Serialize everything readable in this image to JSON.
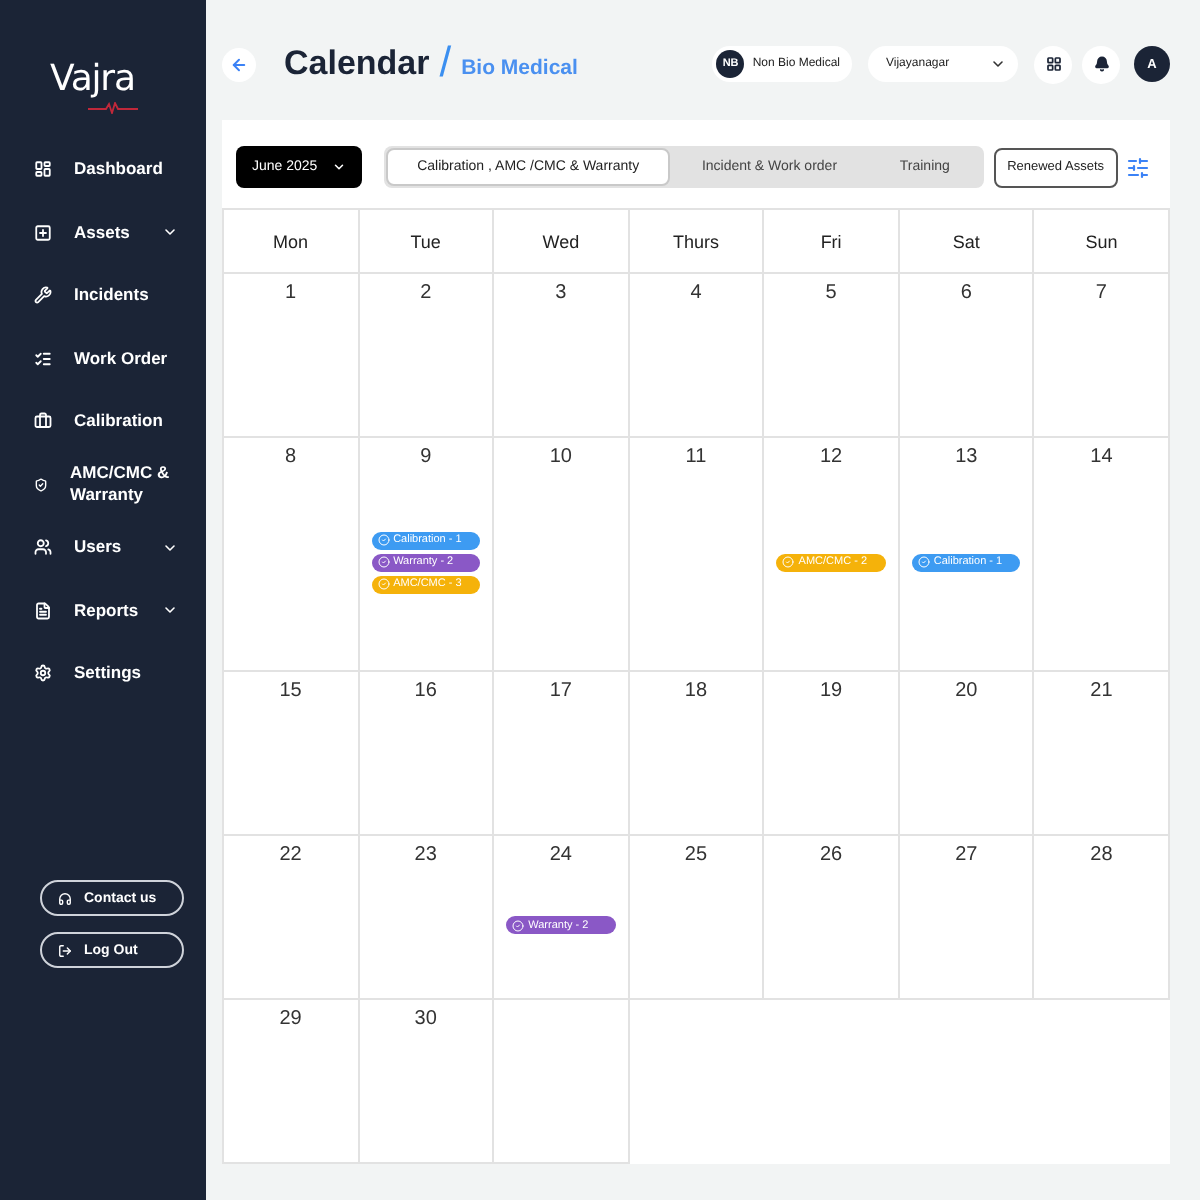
{
  "sidebar": {
    "logo": "Vajra",
    "nav_items": [
      {
        "label": "Dashboard",
        "submenu": false
      },
      {
        "label": "Assets",
        "submenu": true
      },
      {
        "label": "Incidents",
        "submenu": false
      },
      {
        "label": "Work Order",
        "submenu": false
      },
      {
        "label": "Calibration",
        "submenu": false
      },
      {
        "label": "AMC/CMC & Warranty",
        "submenu": false
      },
      {
        "label": "Users",
        "submenu": true
      },
      {
        "label": "Reports",
        "submenu": true
      },
      {
        "label": "Settings",
        "submenu": false
      }
    ],
    "footer_buttons": [
      "Contact us",
      "Log Out"
    ]
  },
  "header": {
    "title": "Calendar",
    "separator": "/",
    "subtitle": "Bio Medical",
    "org_switch": {
      "initials": "NB",
      "label": "Non Bio Medical"
    },
    "location": {
      "value": "Vijayanagar"
    },
    "avatar": "A"
  },
  "toolbar": {
    "month": "June 2025",
    "tabs": [
      {
        "label": "Calibration , AMC /CMC & Warranty",
        "selected": true
      },
      {
        "label": "Incident & Work order",
        "selected": false
      },
      {
        "label": "Training",
        "selected": false
      }
    ],
    "renewed_button": "Renewed Assets"
  },
  "calendar": {
    "weekdays": [
      "Mon",
      "Tue",
      "Wed",
      "Thurs",
      "Fri",
      "Sat",
      "Sun"
    ],
    "weeks": [
      [
        {
          "kind": "day",
          "day": "1"
        },
        {
          "kind": "day",
          "day": "2"
        },
        {
          "kind": "day",
          "day": "3"
        },
        {
          "kind": "day",
          "day": "4"
        },
        {
          "kind": "day",
          "day": "5"
        },
        {
          "kind": "day",
          "day": "6"
        },
        {
          "kind": "day",
          "day": "7"
        }
      ],
      [
        {
          "kind": "day",
          "day": "8"
        },
        {
          "kind": "day",
          "day": "9",
          "events": [
            {
              "label": "Calibration - 1",
              "color": "#3d9bf2"
            },
            {
              "label": "Warranty - 2",
              "color": "#8a58c6"
            },
            {
              "label": "AMC/CMC - 3",
              "color": "#f5b20a"
            }
          ]
        },
        {
          "kind": "day",
          "day": "10"
        },
        {
          "kind": "day",
          "day": "11"
        },
        {
          "kind": "day",
          "day": "12",
          "events": [
            {
              "label": "AMC/CMC - 2",
              "color": "#f5b20a"
            }
          ]
        },
        {
          "kind": "day",
          "day": "13",
          "events": [
            {
              "label": "Calibration - 1",
              "color": "#3d9bf2"
            }
          ]
        },
        {
          "kind": "day",
          "day": "14"
        }
      ],
      [
        {
          "kind": "day",
          "day": "15"
        },
        {
          "kind": "day",
          "day": "16"
        },
        {
          "kind": "day",
          "day": "17"
        },
        {
          "kind": "day",
          "day": "18"
        },
        {
          "kind": "day",
          "day": "19"
        },
        {
          "kind": "day",
          "day": "20"
        },
        {
          "kind": "day",
          "day": "21"
        }
      ],
      [
        {
          "kind": "day",
          "day": "22"
        },
        {
          "kind": "day",
          "day": "23"
        },
        {
          "kind": "day",
          "day": "24",
          "events": [
            {
              "label": "Warranty - 2",
              "color": "#8a58c6"
            }
          ]
        },
        {
          "kind": "day",
          "day": "25"
        },
        {
          "kind": "day",
          "day": "26"
        },
        {
          "kind": "day",
          "day": "27"
        },
        {
          "kind": "day",
          "day": "28"
        }
      ],
      [
        {
          "kind": "day",
          "day": "29"
        },
        {
          "kind": "day",
          "day": "30"
        },
        {
          "kind": "blank"
        }
      ]
    ]
  }
}
